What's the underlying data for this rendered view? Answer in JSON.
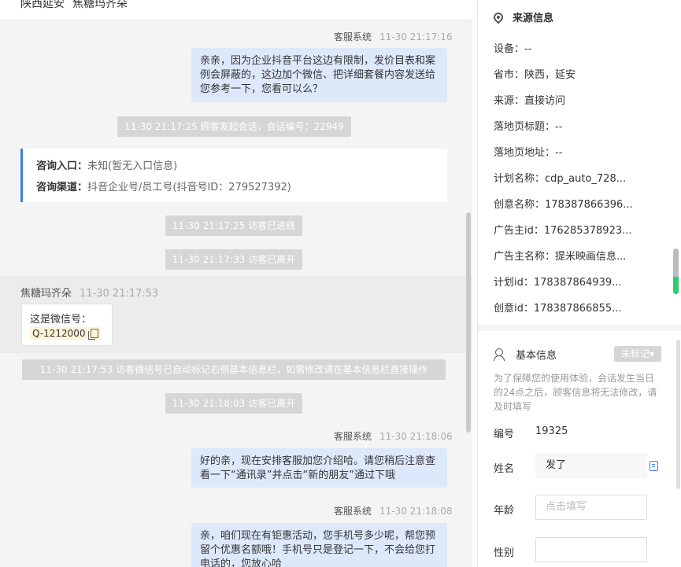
{
  "chat": {
    "header": {
      "location": "陕西延安",
      "visitor_name": "焦糖玛齐朵"
    },
    "messages": [
      {
        "sender": "客服系统",
        "time": "11-30 21:17:16",
        "text": "亲亲，因为企业抖音平台这边有限制，发价目表和案例会屏蔽的，这边加个微信、把详细套餐内容发送给您参考一下，您看可以么？"
      },
      {
        "sender": "客服系统",
        "time": "11-30 21:18:06",
        "text": "好的亲，现在安排客服加您介绍哈。请您稍后注意查看一下“通讯录”并点击“新的朋友”通过下哦"
      },
      {
        "sender": "客服系统",
        "time": "11-30 21:18:08",
        "text": "亲，咱们现在有钜惠活动，您手机号多少呢，帮您预留个优惠名额哦！手机号只是登记一下，不会给您打电话的，您放心哈"
      }
    ],
    "system_notices": [
      "11-30 21:17:25 顾客发起会话，会话编号：22949",
      "11-30 21:17:25 访客已进线",
      "11-30 21:17:33 访客已离开",
      "11-30 21:17:53 访客微信号已自动标记右侧基本信息栏，如需修改请在基本信息栏直接操作",
      "11-30 21:18:03 访客已离开"
    ],
    "source_card": {
      "entry_label": "咨询入口：",
      "entry_value": "未知(暂无入口信息)",
      "channel_label": "咨询渠道：",
      "channel_value": "抖音企业号/员工号(抖音号ID：279527392)"
    },
    "visitor_message": {
      "sender": "焦糖玛齐朵",
      "time": "11-30 21:17:53",
      "text": "这是微信号：",
      "wechat_id": "Q-1212000"
    }
  },
  "panel": {
    "source_title": "来源信息",
    "source_rows": [
      "设备：--",
      "省市：陕西，延安",
      "来源：直接访问",
      "落地页标题：--",
      "落地页地址：--",
      "计划名称：cdp_auto_728...",
      "创意名称：178387866396...",
      "广告主id：176285378923...",
      "广告主名称：提米映画信息...",
      "计划id：178387864939...",
      "创意id：178387866855..."
    ],
    "basic_title": "基本信息",
    "mark_label": "未标记▾",
    "hint": "为了保障您的使用体验，会话发生当日的24点之后，顾客信息将无法修改，请及时填写",
    "fields": {
      "id_label": "编号",
      "id_value": "19325",
      "name_label": "姓名",
      "name_value": "发了",
      "age_label": "年龄",
      "age_placeholder": "点击填写",
      "gender_label": "性别"
    }
  }
}
